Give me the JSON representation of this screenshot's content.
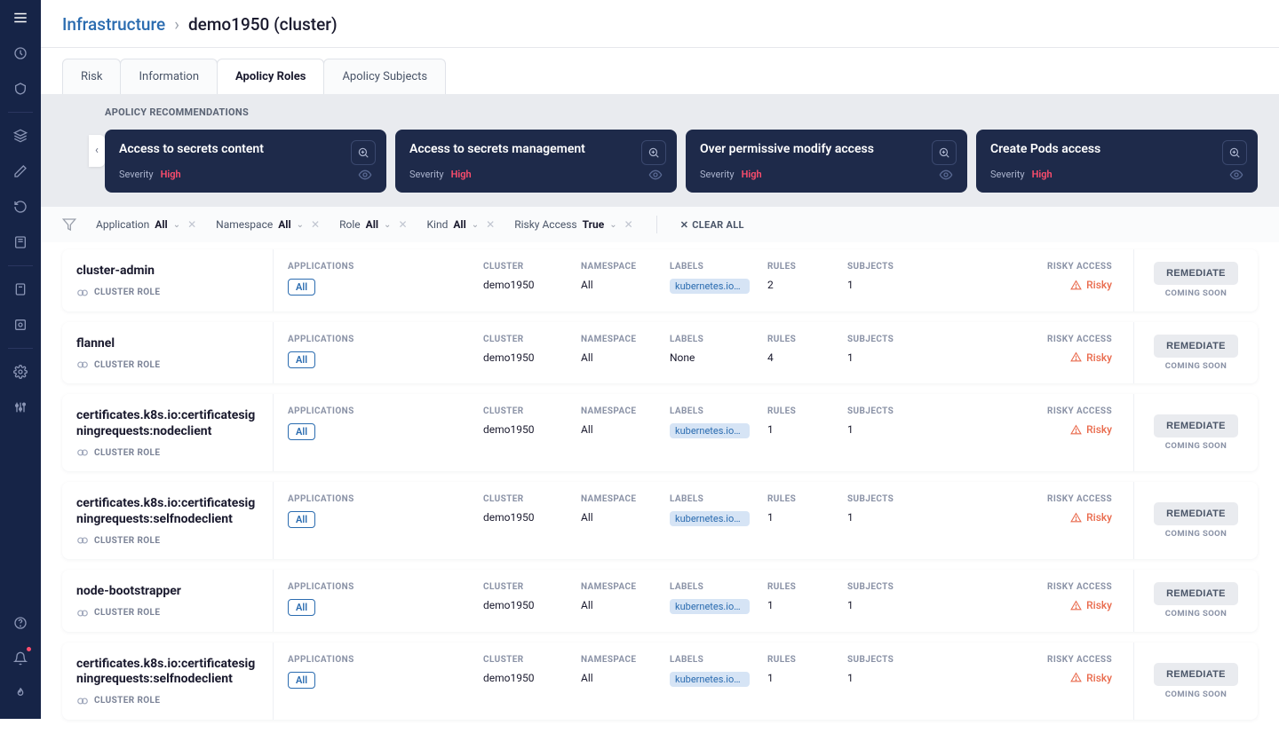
{
  "breadcrumb": {
    "root": "Infrastructure",
    "current": "demo1950 (cluster)"
  },
  "tabs": [
    "Risk",
    "Information",
    "Apolicy Roles",
    "Apolicy Subjects"
  ],
  "activeTab": 2,
  "reco": {
    "label": "APOLICY RECOMMENDATIONS",
    "cards": [
      {
        "title": "Access to secrets content",
        "sevLabel": "Severity",
        "sevVal": "High"
      },
      {
        "title": "Access to secrets management",
        "sevLabel": "Severity",
        "sevVal": "High"
      },
      {
        "title": "Over permissive modify access",
        "sevLabel": "Severity",
        "sevVal": "High"
      },
      {
        "title": "Create Pods access",
        "sevLabel": "Severity",
        "sevVal": "High"
      }
    ]
  },
  "filters": {
    "items": [
      {
        "label": "Application",
        "val": "All"
      },
      {
        "label": "Namespace",
        "val": "All"
      },
      {
        "label": "Role",
        "val": "All"
      },
      {
        "label": "Kind",
        "val": "All"
      },
      {
        "label": "Risky Access",
        "val": "True"
      }
    ],
    "clear": "CLEAR ALL"
  },
  "headers": {
    "apps": "APPLICATIONS",
    "cluster": "CLUSTER",
    "ns": "NAMESPACE",
    "labels": "LABELS",
    "rules": "RULES",
    "subjects": "SUBJECTS",
    "risky": "RISKY ACCESS"
  },
  "common": {
    "all": "All",
    "kind": "CLUSTER ROLE",
    "risky": "Risky",
    "remediate": "REMEDIATE",
    "soon": "COMING SOON"
  },
  "rows": [
    {
      "name": "cluster-admin",
      "cluster": "demo1950",
      "ns": "All",
      "label": "kubernetes.io/…",
      "labelNone": false,
      "rules": "2",
      "subjects": "1"
    },
    {
      "name": "flannel",
      "cluster": "demo1950",
      "ns": "All",
      "label": "None",
      "labelNone": true,
      "rules": "4",
      "subjects": "1"
    },
    {
      "name": "certificates.k8s.io:certificatesigningrequests:nodeclient",
      "cluster": "demo1950",
      "ns": "All",
      "label": "kubernetes.io/…",
      "labelNone": false,
      "rules": "1",
      "subjects": "1"
    },
    {
      "name": "certificates.k8s.io:certificatesigningrequests:selfnodeclient",
      "cluster": "demo1950",
      "ns": "All",
      "label": "kubernetes.io/…",
      "labelNone": false,
      "rules": "1",
      "subjects": "1"
    },
    {
      "name": "node-bootstrapper",
      "cluster": "demo1950",
      "ns": "All",
      "label": "kubernetes.io/…",
      "labelNone": false,
      "rules": "1",
      "subjects": "1"
    },
    {
      "name": "certificates.k8s.io:certificatesigningrequests:selfnodeclient",
      "cluster": "demo1950",
      "ns": "All",
      "label": "kubernetes.io/…",
      "labelNone": false,
      "rules": "1",
      "subjects": "1"
    }
  ]
}
